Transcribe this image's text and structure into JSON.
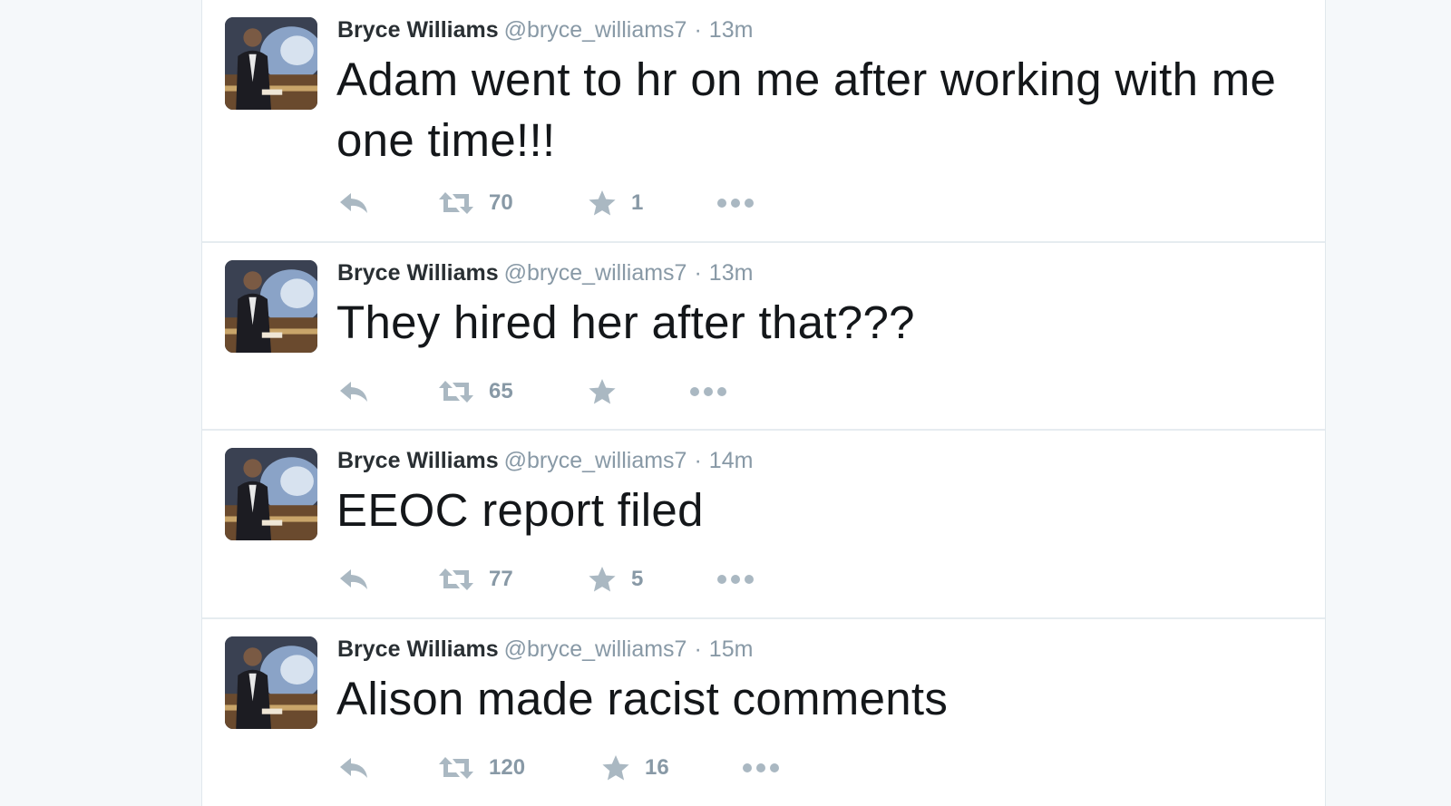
{
  "colors": {
    "background": "#f5f8fa",
    "card": "#ffffff",
    "name": "#292f33",
    "meta": "#8899a6",
    "icon": "#aab8c2",
    "text": "#14171a"
  },
  "icons": [
    "reply-icon",
    "retweet-icon",
    "favorite-star-icon",
    "more-dots-icon"
  ],
  "tweets": [
    {
      "fullname": "Bryce Williams",
      "username": "@bryce_williams7",
      "separator": "·",
      "time": "13m",
      "text": "Adam went to hr on me after working with me one time!!!",
      "retweets": "70",
      "favorites": "1"
    },
    {
      "fullname": "Bryce Williams",
      "username": "@bryce_williams7",
      "separator": "·",
      "time": "13m",
      "text": "They hired her after that???",
      "retweets": "65",
      "favorites": ""
    },
    {
      "fullname": "Bryce Williams",
      "username": "@bryce_williams7",
      "separator": "·",
      "time": "14m",
      "text": "EEOC report filed",
      "retweets": "77",
      "favorites": "5"
    },
    {
      "fullname": "Bryce Williams",
      "username": "@bryce_williams7",
      "separator": "·",
      "time": "15m",
      "text": "Alison made racist comments",
      "retweets": "120",
      "favorites": "16"
    }
  ]
}
